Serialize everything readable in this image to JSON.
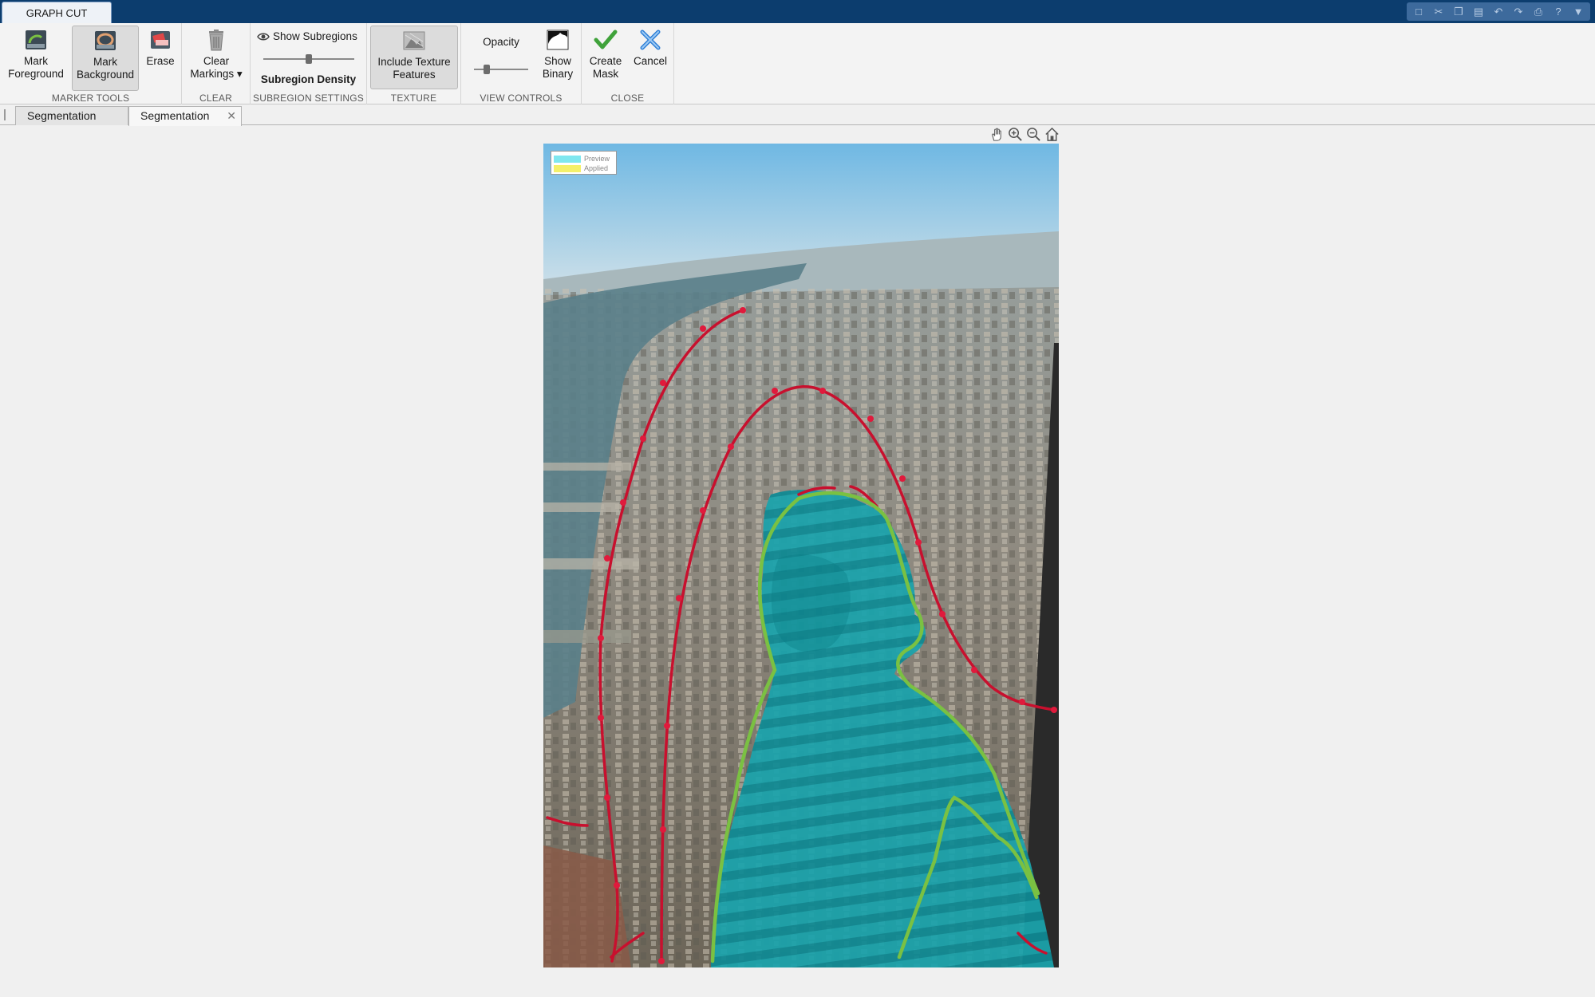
{
  "app": {
    "tab_label": "GRAPH CUT"
  },
  "ribbon": {
    "groups": [
      {
        "label": "MARKER TOOLS"
      },
      {
        "label": "CLEAR"
      },
      {
        "label": "SUBREGION SETTINGS"
      },
      {
        "label": "TEXTURE"
      },
      {
        "label": "VIEW CONTROLS"
      },
      {
        "label": "CLOSE"
      }
    ],
    "mark_foreground": "Mark\nForeground",
    "mark_background": "Mark\nBackground",
    "erase": "Erase",
    "clear_markings": "Clear\nMarkings ▾",
    "show_subregions": "Show Subregions",
    "subregion_density": "Subregion Density",
    "subregion_density_level": 0.5,
    "include_texture": "Include Texture\nFeatures",
    "opacity": "Opacity",
    "opacity_level": 0.2,
    "show_binary": "Show\nBinary",
    "create_mask": "Create\nMask",
    "cancel": "Cancel"
  },
  "document_tabs": [
    {
      "label": "Segmentation",
      "active": false
    },
    {
      "label": "Segmentation",
      "active": true
    }
  ],
  "legend": {
    "preview": "Preview",
    "applied": "Applied",
    "preview_color": "#7fe7ef",
    "applied_color": "#f4f06a"
  },
  "colors": {
    "foreground_marker": "#7ac142",
    "background_marker": "#c8102e",
    "overlay": "#15b5c0",
    "title_bar": "#0c3d6e"
  }
}
